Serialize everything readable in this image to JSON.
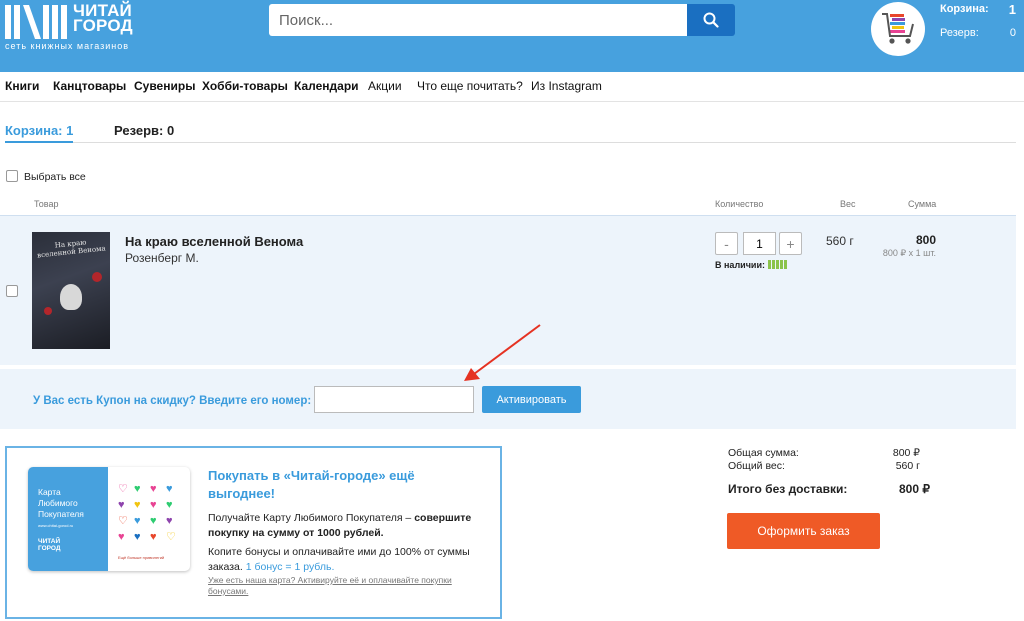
{
  "header": {
    "logo_text_line1": "ЧИТАЙ",
    "logo_text_line2": "ГОРОД",
    "logo_tagline": "сеть книжных магазинов",
    "search_placeholder": "Поиск...",
    "cart_label": "Корзина:",
    "cart_count": "1",
    "reserve_label": "Резерв:",
    "reserve_count": "0"
  },
  "nav": {
    "items": [
      {
        "label": "Книги"
      },
      {
        "label": "Канцтовары"
      },
      {
        "label": "Сувениры"
      },
      {
        "label": "Хобби-товары"
      },
      {
        "label": "Календари"
      },
      {
        "label": "Акции"
      },
      {
        "label": "Что еще почитать?"
      },
      {
        "label": "Из Instagram"
      }
    ]
  },
  "tabs": {
    "cart": "Корзина: 1",
    "reserve": "Резерв: 0"
  },
  "select_all": "Выбрать все",
  "columns": {
    "product": "Товар",
    "quantity": "Количество",
    "weight": "Вес",
    "sum": "Сумма"
  },
  "item": {
    "cover_title": "На краю вселенной Венома",
    "title": "На краю вселенной Венома",
    "author": "Розенберг М.",
    "minus": "-",
    "quantity": "1",
    "plus": "+",
    "availability": "В наличии:",
    "weight": "560 г",
    "sum": "800",
    "sum_detail": "800 ₽ x 1 шт."
  },
  "coupon": {
    "label": "У Вас есть Купон на скидку? Введите его номер:",
    "value": "",
    "button": "Активировать"
  },
  "promo": {
    "card_text_1": "Карта",
    "card_text_2": "Любимого",
    "card_text_3": "Покупателя",
    "card_url": "www.chitai-gorod.ru",
    "card_logo_1": "ЧИТАЙ",
    "card_logo_2": "ГОРОД",
    "card_slogan": "Ещё больше привилегий",
    "title": "Покупать в «Читай-городе» ещё выгоднее!",
    "p1_start": "Получайте Карту Любимого Покупателя – ",
    "p1_bold": "совершите покупку на сумму от 1000 рублей.",
    "p2_start": "Копите бонусы и оплачивайте ими до 100% от суммы заказа. ",
    "p2_link": "1 бонус = 1 рубль.",
    "p3": "Уже есть наша карта? Активируйте её и оплачивайте покупки бонусами."
  },
  "totals": {
    "total_label": "Общая сумма:",
    "total_value": "800 ₽",
    "weight_label": "Общий вес:",
    "weight_value": "560 г",
    "no_delivery_label": "Итого без доставки:",
    "no_delivery_value": "800 ₽",
    "order_button": "Оформить заказ"
  },
  "colors": {
    "brand_blue": "#47a1de",
    "accent_blue": "#3a9bdc",
    "search_button": "#1a6fc1",
    "order_button": "#ef5a26",
    "availability_green": "#8bc34a",
    "arrow_red": "#e53222"
  },
  "icons": {
    "search": "search-icon",
    "cart": "cart-icon",
    "arrow": "red-arrow-annotation"
  }
}
